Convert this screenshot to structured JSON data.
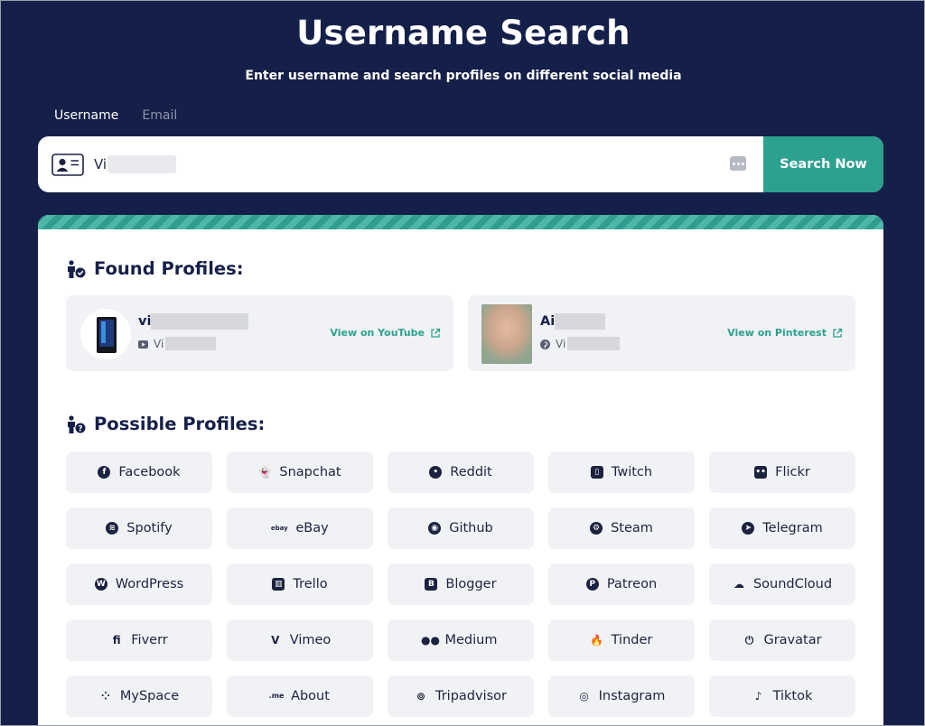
{
  "header": {
    "title": "Username Search",
    "subtitle": "Enter username and search profiles on different social media"
  },
  "tabs": [
    {
      "label": "Username",
      "active": true
    },
    {
      "label": "Email",
      "active": false
    }
  ],
  "search": {
    "value": "Vi",
    "button_label": "Search Now"
  },
  "found": {
    "title": "Found Profiles:",
    "profiles": [
      {
        "name": "vi",
        "sub": "Vi",
        "platform_icon": "youtube-icon",
        "link": "View on YouTube"
      },
      {
        "name": "Ai",
        "sub": "Vi",
        "platform_icon": "pinterest-icon",
        "link": "View on Pinterest"
      }
    ]
  },
  "possible": {
    "title": "Possible Profiles:",
    "items": [
      {
        "label": "Facebook",
        "icon": "facebook-icon"
      },
      {
        "label": "Snapchat",
        "icon": "snapchat-icon"
      },
      {
        "label": "Reddit",
        "icon": "reddit-icon"
      },
      {
        "label": "Twitch",
        "icon": "twitch-icon"
      },
      {
        "label": "Flickr",
        "icon": "flickr-icon"
      },
      {
        "label": "Spotify",
        "icon": "spotify-icon"
      },
      {
        "label": "eBay",
        "icon": "ebay-icon"
      },
      {
        "label": "Github",
        "icon": "github-icon"
      },
      {
        "label": "Steam",
        "icon": "steam-icon"
      },
      {
        "label": "Telegram",
        "icon": "telegram-icon"
      },
      {
        "label": "WordPress",
        "icon": "wordpress-icon"
      },
      {
        "label": "Trello",
        "icon": "trello-icon"
      },
      {
        "label": "Blogger",
        "icon": "blogger-icon"
      },
      {
        "label": "Patreon",
        "icon": "patreon-icon"
      },
      {
        "label": "SoundCloud",
        "icon": "soundcloud-icon"
      },
      {
        "label": "Fiverr",
        "icon": "fiverr-icon"
      },
      {
        "label": "Vimeo",
        "icon": "vimeo-icon"
      },
      {
        "label": "Medium",
        "icon": "medium-icon"
      },
      {
        "label": "Tinder",
        "icon": "tinder-icon"
      },
      {
        "label": "Gravatar",
        "icon": "gravatar-icon"
      },
      {
        "label": "MySpace",
        "icon": "myspace-icon"
      },
      {
        "label": "About",
        "icon": "aboutme-icon"
      },
      {
        "label": "Tripadvisor",
        "icon": "tripadvisor-icon"
      },
      {
        "label": "Instagram",
        "icon": "instagram-icon"
      },
      {
        "label": "Tiktok",
        "icon": "tiktok-icon"
      }
    ]
  },
  "colors": {
    "background": "#15204a",
    "accent": "#2da18f",
    "card": "#ffffff",
    "tile": "#f1f2f5",
    "text": "#16204a"
  }
}
